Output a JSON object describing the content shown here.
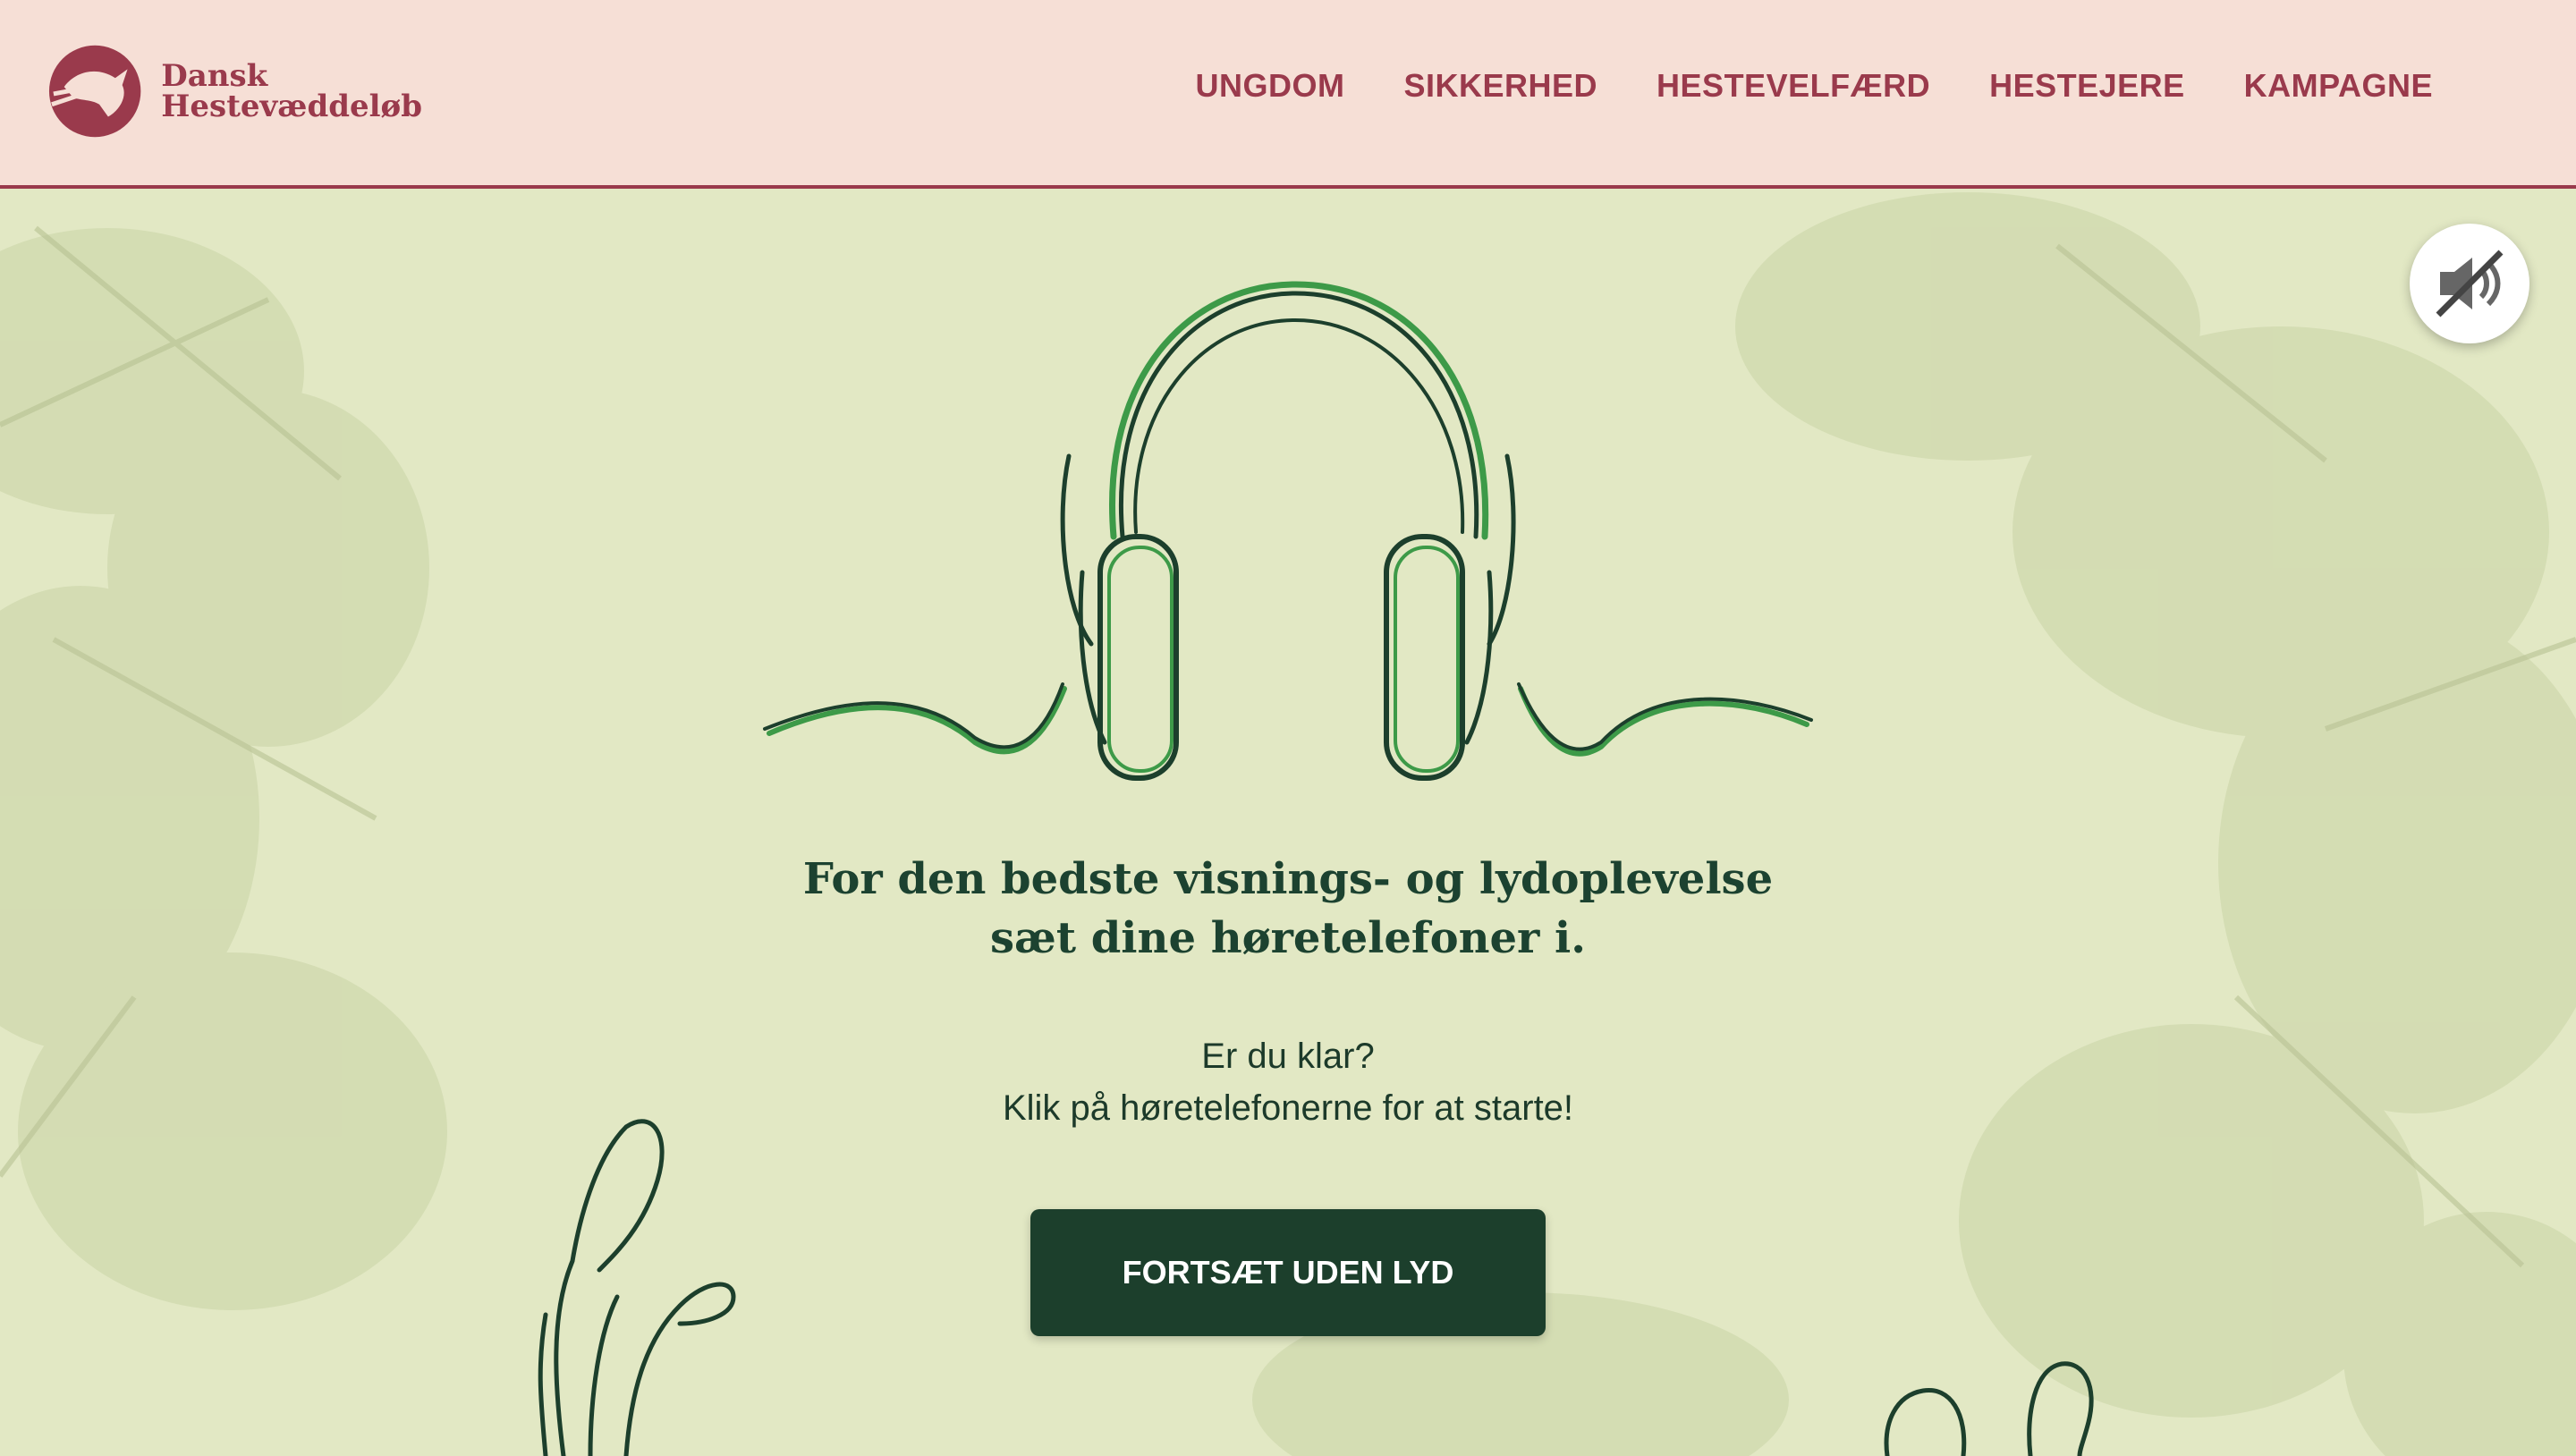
{
  "brand": {
    "line1": "Dansk",
    "line2": "Hestevæddeløb",
    "color": "#9a3a4c"
  },
  "nav": {
    "items": [
      {
        "label": "UNGDOM"
      },
      {
        "label": "SIKKERHED"
      },
      {
        "label": "HESTEVELFÆRD"
      },
      {
        "label": "HESTEJERE"
      },
      {
        "label": "KAMPAGNE"
      }
    ]
  },
  "mute": {
    "icon": "speaker-muted-icon"
  },
  "intro": {
    "title_line1": "For den bedste visnings- og lydoplevelse",
    "title_line2": "sæt dine høretelefoner i.",
    "sub_line1": "Er du klar?",
    "sub_line2": "Klik på høretelefonerne for at starte!",
    "button_label": "FORTSÆT UDEN LYD"
  },
  "colors": {
    "header_bg": "#f6dfd6",
    "page_bg": "#e2e8c4",
    "accent": "#9a3a4c",
    "dark_green": "#1c3f2c",
    "line_green": "#3d9a48"
  }
}
